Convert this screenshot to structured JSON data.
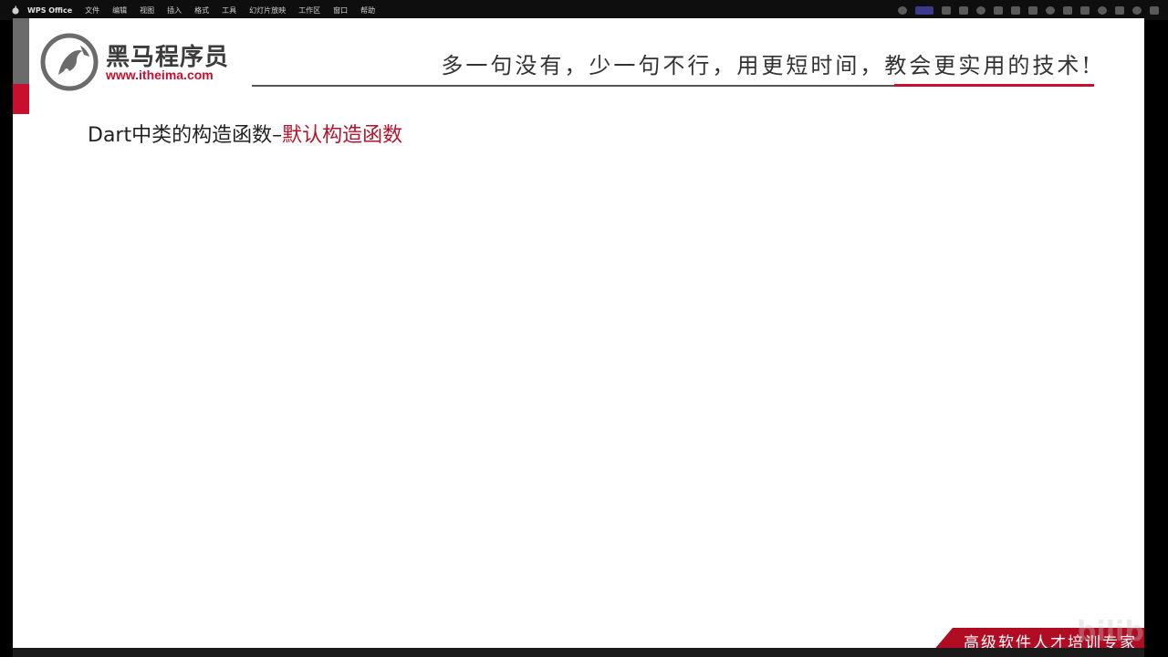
{
  "menubar": {
    "app_name": "WPS Office",
    "items": [
      "文件",
      "编辑",
      "视图",
      "插入",
      "格式",
      "工具",
      "幻灯片放映",
      "工作区",
      "窗口",
      "帮助"
    ]
  },
  "slide": {
    "logo": {
      "brand": "黑马程序员",
      "url": "www.itheima.com"
    },
    "slogan": "多一句没有，少一句不行，用更短时间，教会更实用的技术!",
    "title": {
      "prefix": "Dart中类的构造函数–",
      "highlight": "默认构造函数"
    },
    "footer": "高级软件人才培训专家"
  },
  "watermark": "bilibili",
  "colors": {
    "accent_red": "#c8102e",
    "title_red": "#b5132c",
    "gray": "#6b6b6b"
  }
}
